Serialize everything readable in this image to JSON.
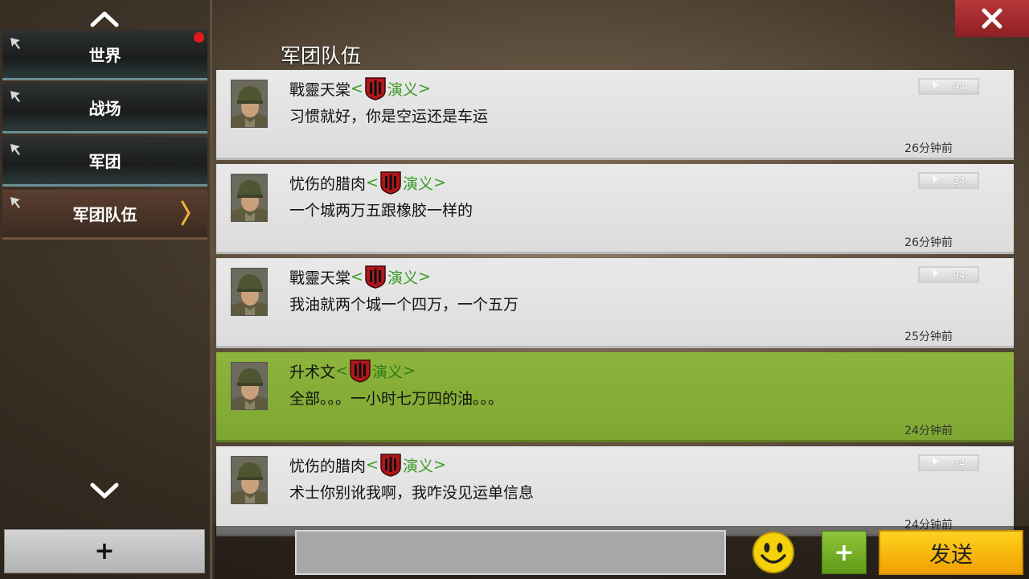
{
  "sidebar": {
    "items": [
      {
        "label": "世界",
        "unread": true
      },
      {
        "label": "战场",
        "unread": false
      },
      {
        "label": "军团",
        "unread": false
      },
      {
        "label": "军团队伍",
        "unread": false,
        "active": true
      }
    ],
    "add_label": "+"
  },
  "header": {
    "title": "军团队伍"
  },
  "messages": [
    {
      "name": "戰靈天棠",
      "guild": "演义",
      "text": "习惯就好，你是空运还是车运",
      "time": "26分钟前",
      "rank": "94",
      "self": false
    },
    {
      "name": "忧伤的腊肉",
      "guild": "演义",
      "text": "一个城两万五跟橡胶一样的",
      "time": "26分钟前",
      "rank": "34",
      "self": false
    },
    {
      "name": "戰靈天棠",
      "guild": "演义",
      "text": "我油就两个城一个四万，一个五万",
      "time": "25分钟前",
      "rank": "94",
      "self": false
    },
    {
      "name": "升术文",
      "guild": "演义",
      "text": "全部。。。一小时七万四的油。。。",
      "time": "24分钟前",
      "rank": "",
      "self": true
    },
    {
      "name": "忧伤的腊肉",
      "guild": "演义",
      "text": "术士你别讹我啊，我咋没见运单信息",
      "time": "24分钟前",
      "rank": "34",
      "self": false
    }
  ],
  "composer": {
    "input_value": "",
    "plus_label": "+",
    "send_label": "发送"
  },
  "colors": {
    "self_message_bg": "#8db43b",
    "guild_text": "#3a9a23",
    "send_button": "#ffc20e",
    "close_button": "#a72d30",
    "unread_dot": "#e0191d"
  },
  "icons": [
    "chevron-up-icon",
    "chevron-down-icon",
    "pin-icon",
    "close-icon",
    "emblem-icon",
    "rank-icon",
    "smiley-icon"
  ]
}
